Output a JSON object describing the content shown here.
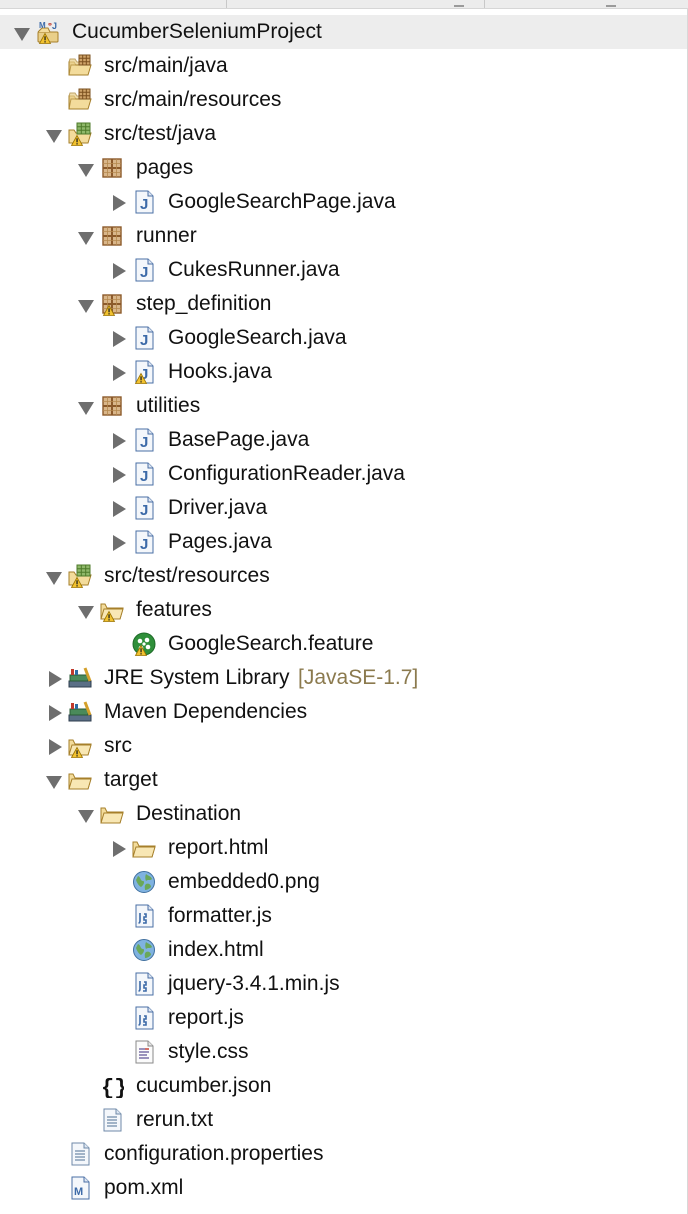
{
  "project": {
    "label": "CucumberSeleniumProject"
  },
  "tree": {
    "src_main_java": "src/main/java",
    "src_main_resources": "src/main/resources",
    "src_test_java": "src/test/java",
    "pkg_pages": "pages",
    "file_googlesearchpage": "GoogleSearchPage.java",
    "pkg_runner": "runner",
    "file_cukesrunner": "CukesRunner.java",
    "pkg_step_definition": "step_definition",
    "file_googlesearch": "GoogleSearch.java",
    "file_hooks": "Hooks.java",
    "pkg_utilities": "utilities",
    "file_basepage": "BasePage.java",
    "file_configreader": "ConfigurationReader.java",
    "file_driver": "Driver.java",
    "file_pages": "Pages.java",
    "src_test_resources": "src/test/resources",
    "folder_features": "features",
    "file_feature": "GoogleSearch.feature",
    "jre_library": "JRE System Library",
    "jre_decoration": "[JavaSE-1.7]",
    "maven_deps": "Maven Dependencies",
    "folder_src": "src",
    "folder_target": "target",
    "folder_destination": "Destination",
    "folder_report_html": "report.html",
    "file_embedded": "embedded0.png",
    "file_formatter": "formatter.js",
    "file_index": "index.html",
    "file_jquery": "jquery-3.4.1.min.js",
    "file_reportjs": "report.js",
    "file_style": "style.css",
    "file_cucumber_json": "cucumber.json",
    "file_rerun": "rerun.txt",
    "file_config_props": "configuration.properties",
    "file_pom": "pom.xml"
  },
  "icons": {
    "project": "maven-java-project-icon",
    "source_folder": "source-folder-icon",
    "package": "package-icon",
    "java_file": "java-file-icon",
    "folder": "folder-icon",
    "feature_file": "cucumber-feature-icon",
    "library": "library-icon",
    "web_file": "globe-icon",
    "js_file": "js-file-icon",
    "css_file": "css-file-icon",
    "json_file": "json-braces-icon",
    "text_file": "text-file-icon",
    "pom_file": "maven-pom-icon",
    "warning": "warning-overlay-icon"
  },
  "colors": {
    "selected_row": "#ededed",
    "decoration_text": "#8b7a4e",
    "warning": "#f2c230",
    "java_blue": "#3c6aa8",
    "package_brown": "#8c5a2b"
  }
}
